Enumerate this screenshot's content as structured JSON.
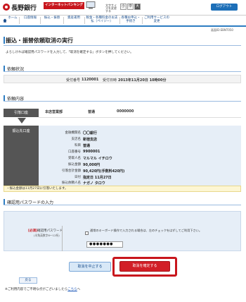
{
  "header": {
    "bank_name": "長野銀行",
    "ib_banner": "インターネットバンキング",
    "fontsize_label": "文字サイズを変更する",
    "fontsize_small": "小",
    "fontsize_mid": "中",
    "fontsize_large": "大",
    "logout": "ログアウト"
  },
  "nav": {
    "items": [
      "ホーム",
      "口座情報",
      "振込・振替",
      "資産運用",
      "税金・各種料金のお支払（ペイジー）",
      "各種お申込・手続き",
      "ご利用サービスの変更"
    ]
  },
  "screen_id": "画面ID:EBNT050",
  "title": "振込・振替依頼取消の実行",
  "intro": "よろしければ確認用パスワードを入力して、「取消を確定する」ボタンを押してください。",
  "request_status": {
    "heading": "依頼状況",
    "reception_no_label": "受付番号",
    "reception_no": "1120001",
    "reception_date_label": "受付日時",
    "reception_date": "2013年11月20日 10時00分"
  },
  "content": {
    "heading": "依頼内容",
    "from_label": "引落口座",
    "from_branch": "本店営業部",
    "from_type": "普通",
    "from_number": "0000000",
    "to_label": "振込先口座",
    "fields": [
      {
        "label": "金融機関名",
        "value": "〇〇銀行"
      },
      {
        "label": "支店名",
        "value": "新宿支店"
      },
      {
        "label": "科目",
        "value": "普通"
      },
      {
        "label": "口座番号",
        "value": "9900001"
      },
      {
        "label": "受取人名",
        "value": "マルマル イチロウ"
      },
      {
        "label": "振込金額",
        "value": "90,000円"
      },
      {
        "label": "引落合計金額",
        "value": "90,420円(手数料420円)"
      },
      {
        "label": "日付",
        "value": "指定日 11月27日"
      },
      {
        "label": "振込依頼人名",
        "value": "ナガノ タロウ"
      }
    ],
    "notice": "・振込金額は11月27日に引落いたします。"
  },
  "password": {
    "heading": "確認用パスワードの入力",
    "required": "[必須]",
    "label": "確認用パスワード",
    "sub": "(半角英数字6〜12桁)",
    "keyboard_note": "通常のキーボード操作で入力される場合は、左のチェックをはずしてご利用下さい。",
    "value": "●●●●●●●"
  },
  "buttons": {
    "cancel": "取消を中止する",
    "confirm": "取消を確定する",
    "back": "戻る"
  },
  "help": {
    "text": "※ご利用内容でご不明な点がございましたら",
    "link": "こちら",
    "suffix": "へ"
  }
}
